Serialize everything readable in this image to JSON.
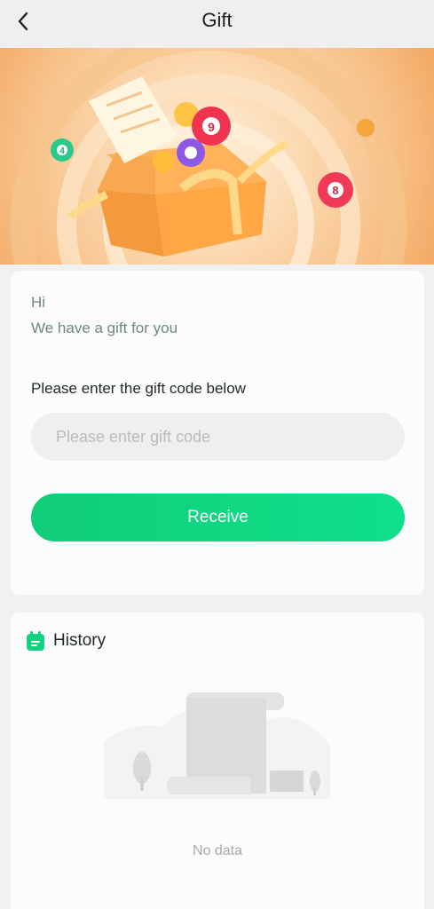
{
  "header": {
    "title": "Gift",
    "back_icon": "chevron-left-icon"
  },
  "banner": {
    "description_icon": "gift-box-with-lottery-balls",
    "ball_numbers": [
      "4",
      "9",
      "8"
    ]
  },
  "gift_card": {
    "greeting": "Hi",
    "subtitle": "We have a gift for you",
    "prompt": "Please enter the gift code below",
    "input_placeholder": "Please enter gift code",
    "input_value": "",
    "button_label": "Receive"
  },
  "history": {
    "title": "History",
    "icon": "calendar-icon",
    "empty_text": "No data"
  },
  "colors": {
    "accent": "#12D27F",
    "muted_text": "#6C8A7A",
    "background": "#F1F1F1"
  }
}
